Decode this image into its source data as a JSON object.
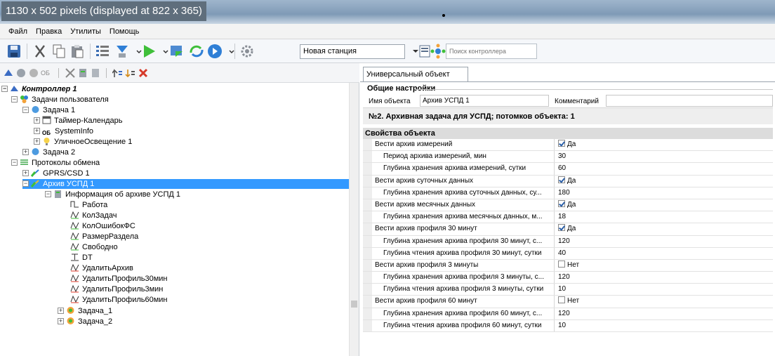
{
  "caption": "1130 x 502 pixels (displayed at 822 x 365)",
  "menu": [
    "Файл",
    "Правка",
    "Утилиты",
    "Помощь"
  ],
  "toolbar": {
    "station": "Новая станция",
    "search_placeholder": "Поиск контроллера"
  },
  "tree": [
    {
      "label": "Контроллер 1",
      "exp": "⊟"
    },
    {
      "label": "Задачи пользователя",
      "exp": "⊟"
    },
    {
      "label": "Задача 1",
      "exp": "⊟"
    },
    {
      "label": "Таймер-Календарь",
      "exp": "⊞"
    },
    {
      "label": "SystemInfo",
      "exp": "⊞"
    },
    {
      "label": "УличноеОсвещение 1",
      "exp": "⊞"
    },
    {
      "label": "Задача 2",
      "exp": "⊞"
    },
    {
      "label": "Протоколы обмена",
      "exp": "⊟"
    },
    {
      "label": "GPRS/CSD 1",
      "exp": "⊞"
    },
    {
      "label": "Архив УСПД 1",
      "exp": "⊟"
    },
    {
      "label": "Информация об архиве УСПД 1",
      "exp": "⊟"
    },
    {
      "label": "Работа"
    },
    {
      "label": "КолЗадач"
    },
    {
      "label": "КолОшибокФС"
    },
    {
      "label": "РазмерРаздела"
    },
    {
      "label": "Свободно"
    },
    {
      "label": "DT"
    },
    {
      "label": "УдалитьАрхив"
    },
    {
      "label": "УдалитьПрофиль30мин"
    },
    {
      "label": "УдалитьПрофиль3мин"
    },
    {
      "label": "УдалитьПрофиль60мин"
    },
    {
      "label": "Задача_1",
      "exp": "⊞"
    },
    {
      "label": "Задача_2",
      "exp": "⊞"
    }
  ],
  "right": {
    "tab": "Универсальный объект",
    "general_title": "Общие настройки",
    "name_label": "Имя объекта",
    "name_value": "Архив УСПД 1",
    "comment_label": "Комментарий",
    "info": "№2. Архивная задача для УСПД; потомков объекта: 1",
    "props_title": "Свойства объекта",
    "props": [
      {
        "name": "Вести архив измерений",
        "value": "Да",
        "check": true
      },
      {
        "name": "Период архива измерений, мин",
        "value": "30"
      },
      {
        "name": "Глубина хранения архива измерений, сутки",
        "value": "60"
      },
      {
        "name": "Вести архив суточных данных",
        "value": "Да",
        "check": true
      },
      {
        "name": "Глубина хранения архива суточных данных, су...",
        "value": "180"
      },
      {
        "name": "Вести архив месячных данных",
        "value": "Да",
        "check": true
      },
      {
        "name": "Глубина хранения архива месячных данных, м...",
        "value": "18"
      },
      {
        "name": "Вести архив профиля 30 минут",
        "value": "Да",
        "check": true
      },
      {
        "name": "Глубина хранения архива профиля 30 минут, с...",
        "value": "120"
      },
      {
        "name": "Глубина чтения архива профиля 30 минут, сутки",
        "value": "40"
      },
      {
        "name": "Вести архив профиля 3 минуты",
        "value": "Нет",
        "check": false
      },
      {
        "name": "Глубина хранения архива профиля 3 минуты, с...",
        "value": "120"
      },
      {
        "name": "Глубина чтения архива профиля 3 минуты, сутки",
        "value": "10"
      },
      {
        "name": "Вести архив профиля 60 минут",
        "value": "Нет",
        "check": false
      },
      {
        "name": "Глубина хранения архива профиля 60 минут, с...",
        "value": "120"
      },
      {
        "name": "Глубина чтения архива профиля 60 минут, сутки",
        "value": "10"
      }
    ]
  }
}
